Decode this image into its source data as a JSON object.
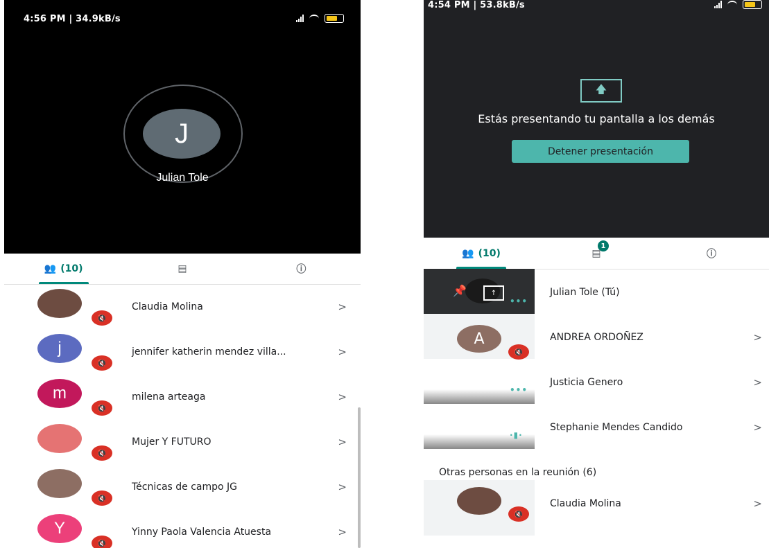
{
  "left": {
    "status_time": "4:56 PM | 34.9kB/s",
    "caller": {
      "initial": "J",
      "name": "Julian Tole"
    },
    "tabs": {
      "people": "(10)"
    },
    "participants": [
      {
        "name": "Claudia Molina",
        "initial": "",
        "color": "#6d4c41"
      },
      {
        "name": "jennifer katherin mendez villa...",
        "initial": "j",
        "color": "#5c6bc0"
      },
      {
        "name": "milena arteaga",
        "initial": "m",
        "color": "#c2185b"
      },
      {
        "name": "Mujer Y FUTURO",
        "initial": "",
        "color": "#e57373"
      },
      {
        "name": "Técnicas de campo JG",
        "initial": "",
        "color": "#8d6e63"
      },
      {
        "name": "Yinny Paola Valencia Atuesta",
        "initial": "Y",
        "color": "#ec407a"
      }
    ]
  },
  "right": {
    "status_time": "4:54 PM | 53.8kB/s",
    "presenting_text": "Estás presentando tu pantalla a los demás",
    "stop_button": "Detener presentación",
    "tabs": {
      "people": "(10)",
      "chat_badge": "1"
    },
    "participants": [
      {
        "name": "Julian Tole (Tú)"
      },
      {
        "name": "ANDREA ORDOÑEZ",
        "initial": "A",
        "color": "#8d6e63"
      },
      {
        "name": "Justicia Genero"
      },
      {
        "name": "Stephanie Mendes Candido"
      }
    ],
    "others_label": "Otras personas en la reunión (6)",
    "others": [
      {
        "name": "Claudia Molina"
      }
    ]
  },
  "colors": {
    "accent": "#00796b",
    "mute": "#d93025",
    "button": "#4db6ac"
  }
}
